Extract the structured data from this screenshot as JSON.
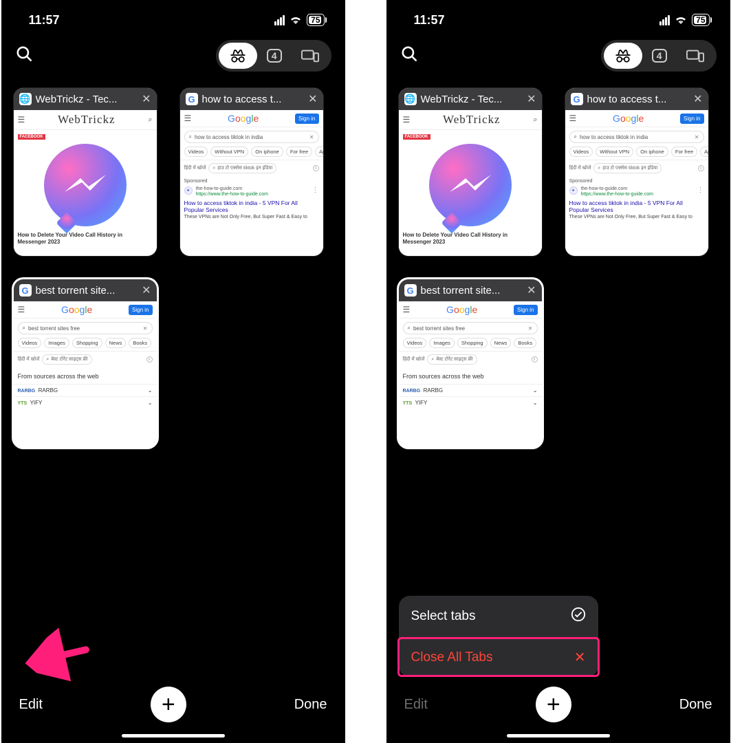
{
  "status": {
    "time": "11:57",
    "battery_pct": "75"
  },
  "toolbar": {
    "tab_count": "4"
  },
  "tabs": [
    {
      "title": "WebTrickz - Tec...",
      "favicon": "🌐",
      "kind": "webtrickz",
      "preview": {
        "logo": "WebTrickz",
        "badge": "FACEBOOK",
        "headline": "How to Delete Your Video Call History in Messenger 2023"
      }
    },
    {
      "title": "how to access t...",
      "favicon": "G",
      "kind": "google",
      "preview": {
        "query": "how to access tiktok in india",
        "chips": [
          "Videos",
          "Without VPN",
          "On iphone",
          "For free",
          "Ap"
        ],
        "hindi_label": "हिंदी में खोजें",
        "hindi_query": "हाउ टो एक्सेस tiktok इन इंडिया",
        "sponsored_label": "Sponsored",
        "ad_url": "the-how-to-guide.com",
        "ad_url2": "https://www.the-how-to-guide.com",
        "result_title": "How to access tiktok in india - 5 VPN For All Popular Services",
        "result_desc": "These VPNs are Not Only Free, But Super Fast & Easy to"
      }
    },
    {
      "title": "best torrent site...",
      "favicon": "G",
      "kind": "google2",
      "preview": {
        "query": "best torrent sites free",
        "chips": [
          "Videos",
          "Images",
          "Shopping",
          "News",
          "Books"
        ],
        "hindi_label": "हिंदी में खोजें",
        "hindi_query": "बेस्ट टोरेंट साइट्स फ्री",
        "sources": "From sources across the web",
        "row1_brand": "RARBG",
        "row1_label": "RARBG",
        "row2_brand": "YTS",
        "row2_label": "YIFY"
      }
    }
  ],
  "bottom": {
    "edit": "Edit",
    "done": "Done"
  },
  "popup": {
    "select": "Select tabs",
    "close_all": "Close All Tabs"
  },
  "signin": "Sign in"
}
